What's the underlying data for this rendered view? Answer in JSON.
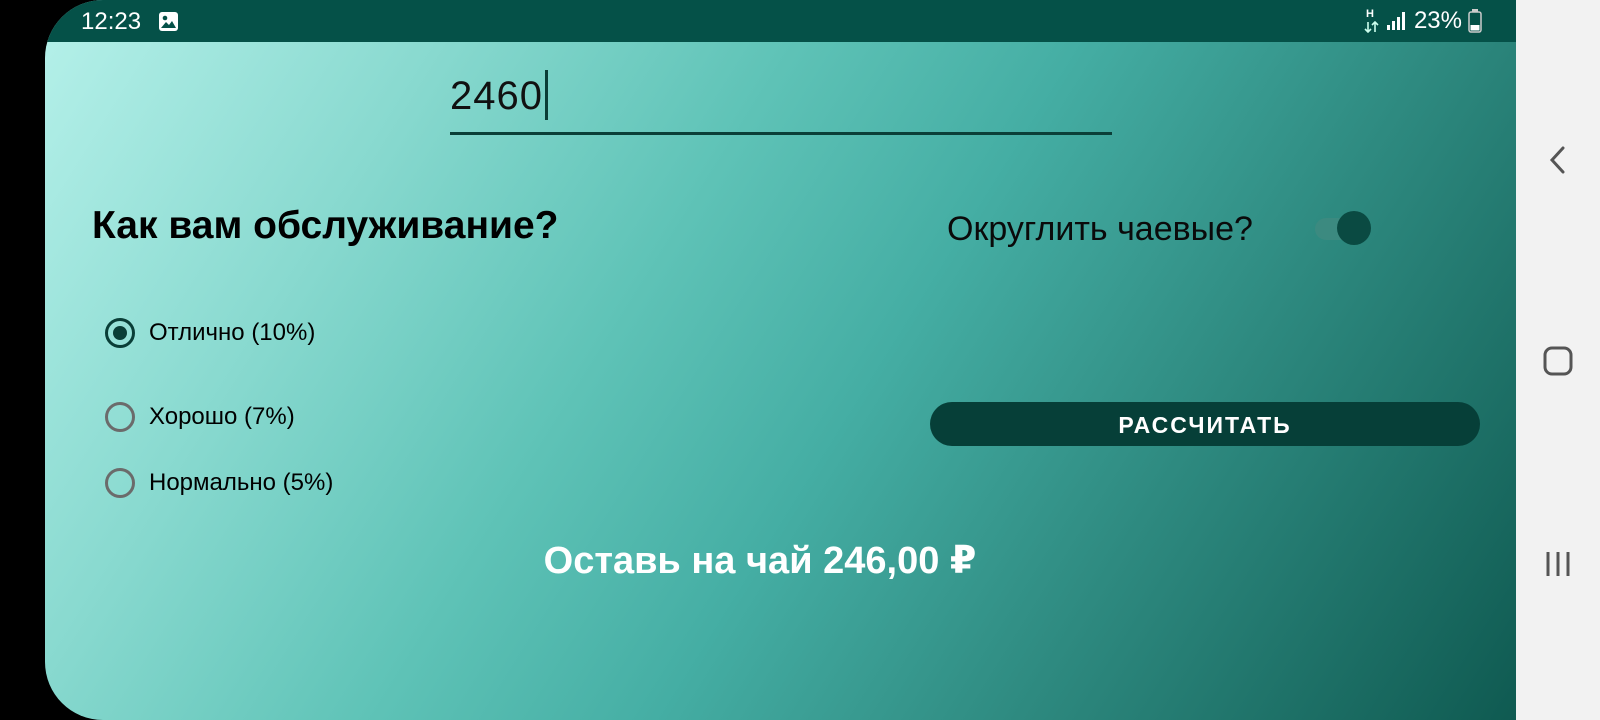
{
  "status_bar": {
    "time": "12:23",
    "network": "H",
    "battery": "23%",
    "icons": [
      "gallery-icon",
      "data-transfer-icon",
      "signal-icon",
      "battery-icon"
    ]
  },
  "amount": {
    "value": "2460"
  },
  "service": {
    "question": "Как вам обслуживание?",
    "options": [
      {
        "label": "Отлично (10%)",
        "checked": true
      },
      {
        "label": "Хорошо (7%)",
        "checked": false
      },
      {
        "label": "Нормально (5%)",
        "checked": false
      }
    ]
  },
  "round_tip": {
    "label": "Округлить чаевые?",
    "on": true
  },
  "calculate": {
    "label": "РАССЧИТАТЬ"
  },
  "result": {
    "text": "Оставь на чай 246,00 ₽"
  },
  "nav_bar": {
    "buttons": [
      "back-icon",
      "home-icon",
      "recents-icon"
    ]
  },
  "colors": {
    "status_bar_bg": "#055148",
    "accent": "#063f38",
    "gradient_start": "#b6f1ea",
    "gradient_end": "#0f5a51"
  }
}
